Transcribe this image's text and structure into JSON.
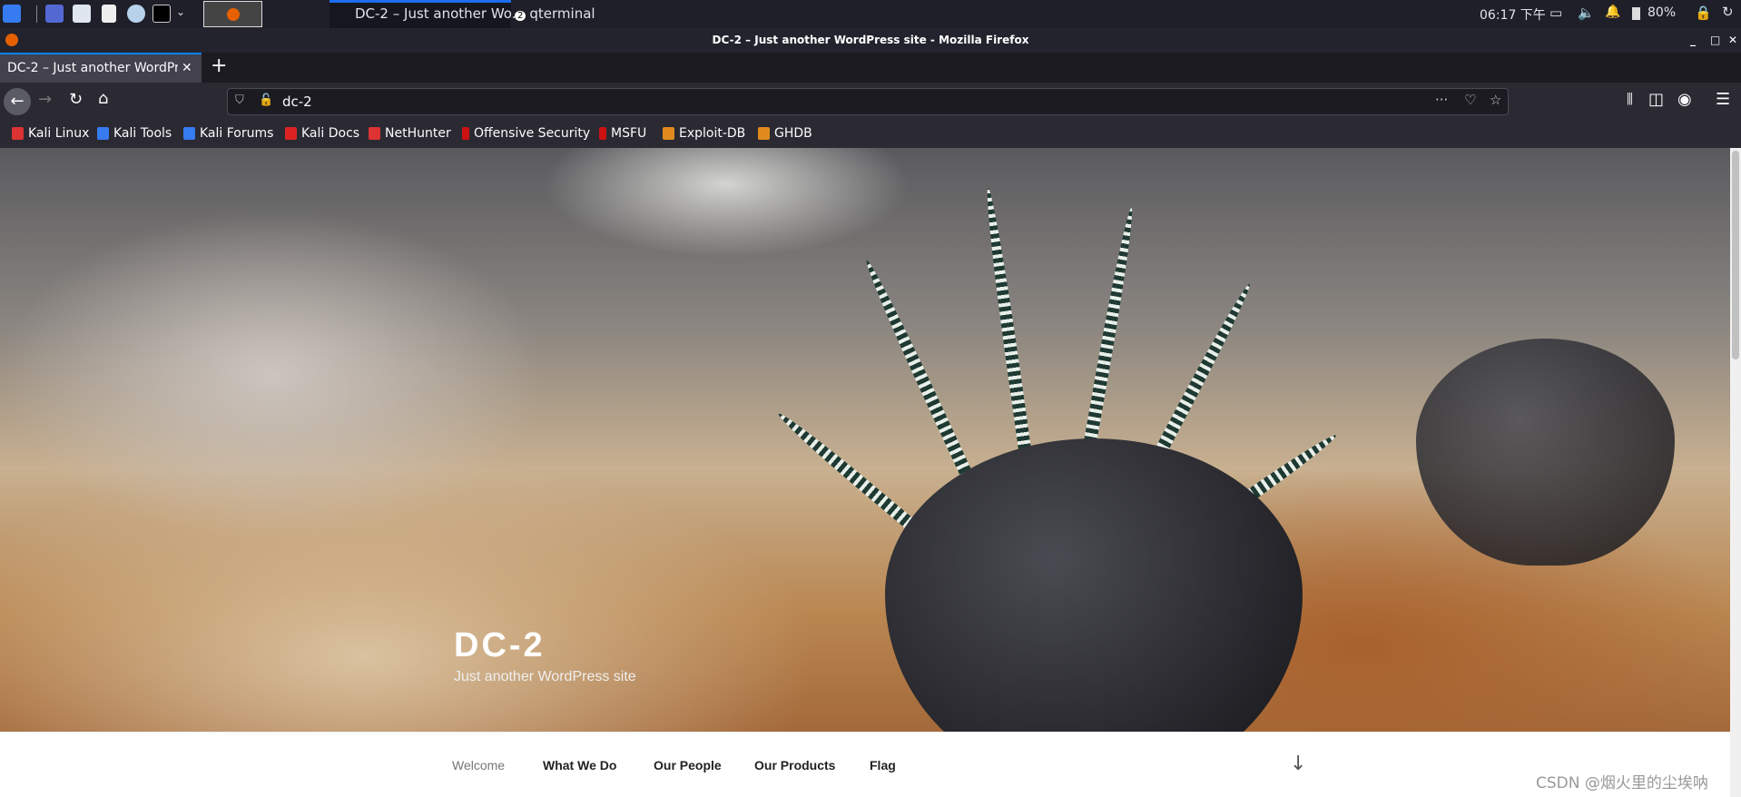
{
  "taskbar": {
    "window_firefox": "DC-2 – Just another Wo...",
    "window_terminal": "qterminal",
    "terminal_count": "2",
    "clock": "06:17 下午",
    "battery": "80%"
  },
  "window": {
    "title": "DC-2 – Just another WordPress site - Mozilla Firefox"
  },
  "browser": {
    "tab_title": "DC-2 – Just another WordPress site",
    "url": "dc-2",
    "bookmarks": [
      {
        "label": "Kali Linux",
        "icon": "kali-icon"
      },
      {
        "label": "Kali Tools",
        "icon": "kali-tools-icon"
      },
      {
        "label": "Kali Forums",
        "icon": "kali-forums-icon"
      },
      {
        "label": "Kali Docs",
        "icon": "kali-docs-icon"
      },
      {
        "label": "NetHunter",
        "icon": "nethunter-icon"
      },
      {
        "label": "Offensive Security",
        "icon": "offsec-icon"
      },
      {
        "label": "MSFU",
        "icon": "msfu-icon"
      },
      {
        "label": "Exploit-DB",
        "icon": "exploit-db-icon"
      },
      {
        "label": "GHDB",
        "icon": "ghdb-icon"
      }
    ]
  },
  "site": {
    "title": "DC-2",
    "tagline": "Just another WordPress site",
    "menu": [
      {
        "label": "Welcome",
        "active": true
      },
      {
        "label": "What We Do"
      },
      {
        "label": "Our People"
      },
      {
        "label": "Our Products"
      },
      {
        "label": "Flag"
      }
    ]
  },
  "watermark": "CSDN @烟火里的尘埃呐",
  "colors": {
    "accent": "#0a84ff",
    "toolbar": "#2b2a33"
  }
}
